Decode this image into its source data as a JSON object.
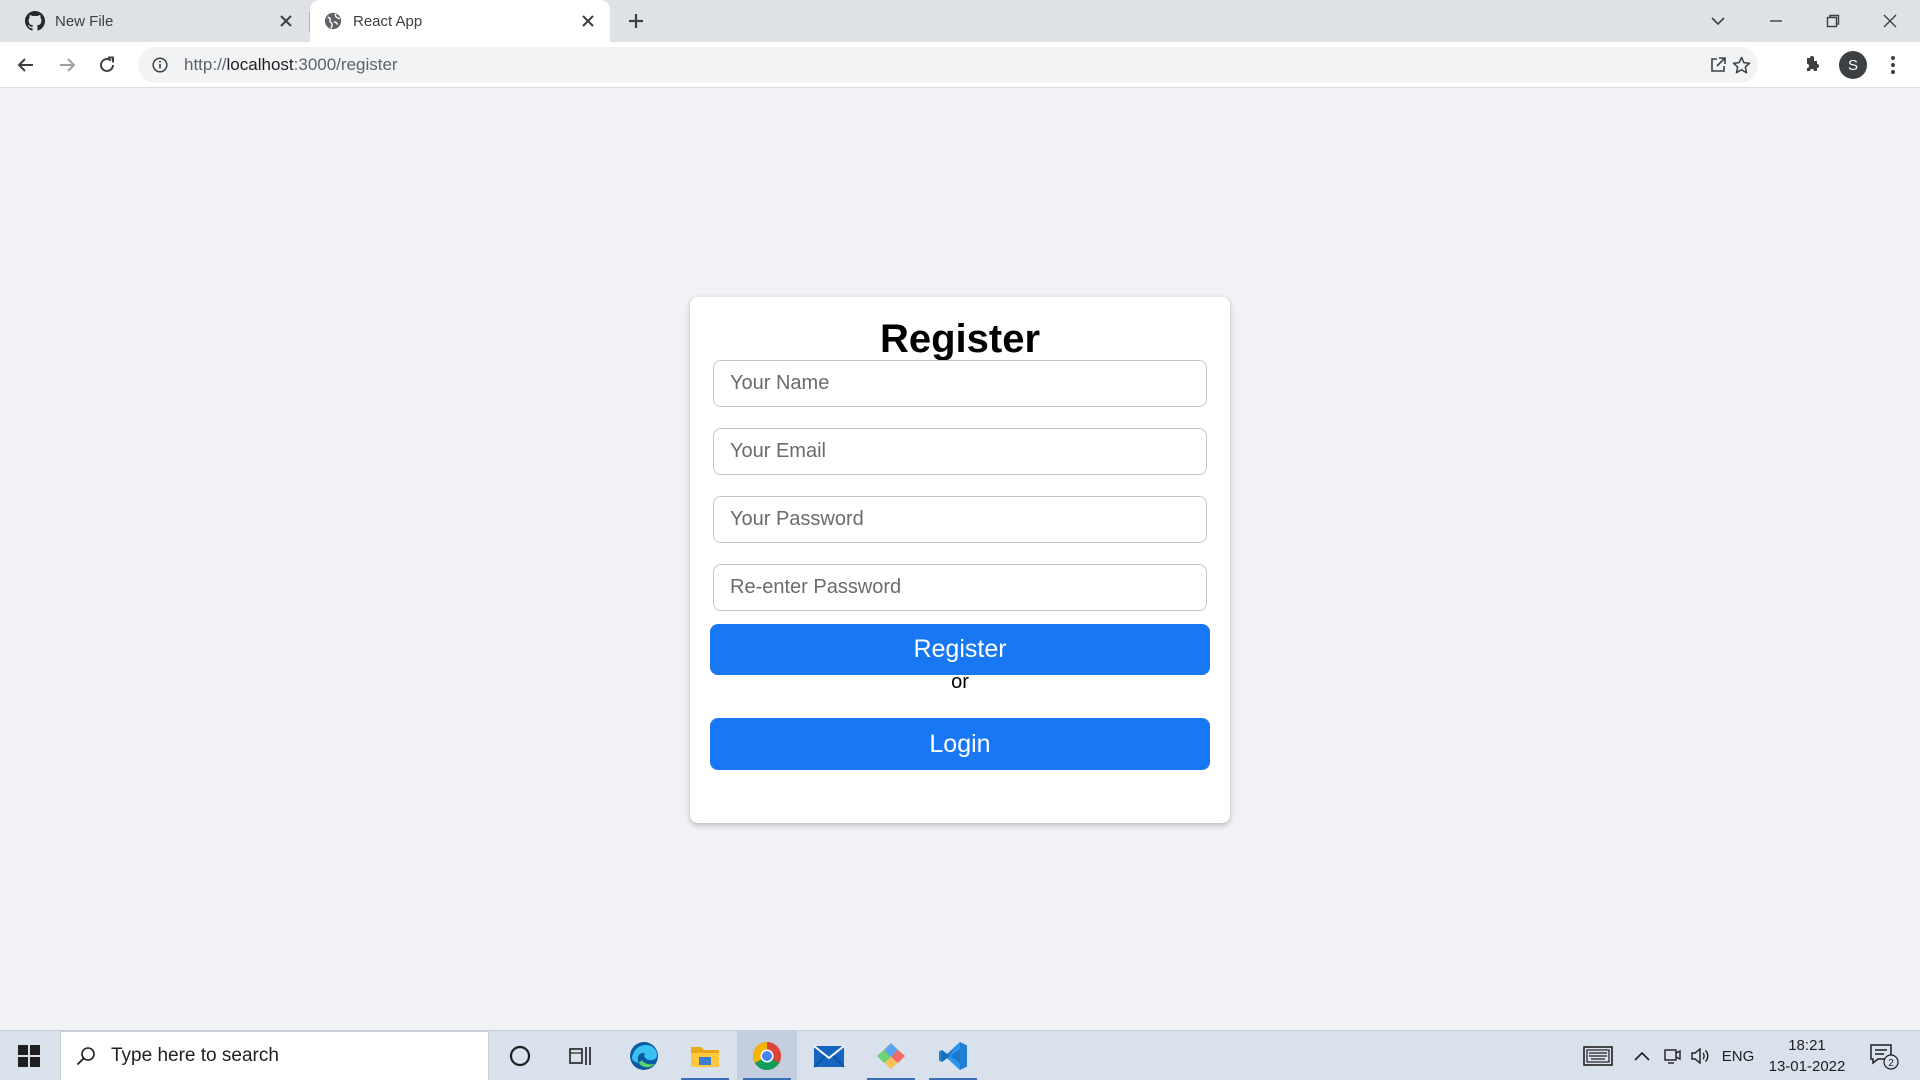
{
  "browser": {
    "tabs": [
      {
        "title": "New File",
        "favicon": "github-icon",
        "active": false
      },
      {
        "title": "React App",
        "favicon": "globe-icon",
        "active": true
      }
    ],
    "url_scheme": "http://",
    "url_host": "localhost",
    "url_path": ":3000/register",
    "profile_initial": "S"
  },
  "page": {
    "heading": "Register",
    "fields": [
      {
        "placeholder": "Your Name",
        "type": "text"
      },
      {
        "placeholder": "Your Email",
        "type": "email"
      },
      {
        "placeholder": "Your Password",
        "type": "password"
      },
      {
        "placeholder": "Re-enter Password",
        "type": "password"
      }
    ],
    "register_button": "Register",
    "separator": "or",
    "login_button": "Login",
    "accent_color": "#1877f2"
  },
  "taskbar": {
    "search_placeholder": "Type here to search",
    "apps": [
      "cortana-icon",
      "task-view-icon",
      "edge-icon",
      "file-explorer-icon",
      "chrome-icon",
      "mail-icon",
      "git-icon",
      "vscode-icon"
    ],
    "language": "ENG",
    "time": "18:21",
    "date": "13-01-2022",
    "notification_count": "2"
  }
}
